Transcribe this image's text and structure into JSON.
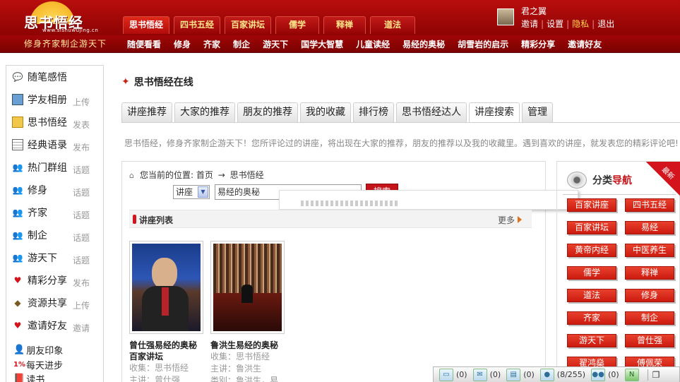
{
  "header": {
    "logo_text": "思书悟经",
    "logo_url": "www.sishuwujing.cn",
    "slogan": "修身齐家制企游天下",
    "top_tabs": [
      "思书悟经",
      "四书五经",
      "百家讲坛",
      "儒学",
      "释禅",
      "道法"
    ],
    "nav_links": [
      "随便看看",
      "修身",
      "齐家",
      "制企",
      "游天下",
      "国学大智慧",
      "儿童读经",
      "易经的奥秘",
      "胡雪岩的启示",
      "精彩分享",
      "邀请好友"
    ],
    "user": {
      "name": "君之翼",
      "links": [
        "邀请",
        "设置",
        "隐私",
        "退出"
      ]
    }
  },
  "sidebar": {
    "items": [
      {
        "label": "随笔感悟",
        "action": "",
        "icon": "chat-bubble-icon"
      },
      {
        "label": "学友相册",
        "action": "上传",
        "icon": "photo-icon"
      },
      {
        "label": "思书悟经",
        "action": "发表",
        "icon": "book-icon"
      },
      {
        "label": "经典语录",
        "action": "发布",
        "icon": "calendar-icon"
      },
      {
        "label": "热门群组",
        "action": "话题",
        "icon": "group-icon"
      },
      {
        "label": "修身",
        "action": "话题",
        "icon": "group-icon"
      },
      {
        "label": "齐家",
        "action": "话题",
        "icon": "group-icon"
      },
      {
        "label": "制企",
        "action": "话题",
        "icon": "group-icon"
      },
      {
        "label": "游天下",
        "action": "话题",
        "icon": "group-icon"
      },
      {
        "label": "精彩分享",
        "action": "发布",
        "icon": "hearts-icon"
      },
      {
        "label": "资源共享",
        "action": "上传",
        "icon": "diamond-icon"
      },
      {
        "label": "邀请好友",
        "action": "邀请",
        "icon": "hearts-icon"
      }
    ],
    "extras": [
      {
        "label": "朋友印象",
        "icon": "people-icon"
      },
      {
        "label": "每天进步",
        "prefix": "1%",
        "icon": "progress-icon"
      },
      {
        "label": "读书",
        "icon": "reading-icon"
      }
    ]
  },
  "main": {
    "title": "思书悟经在线",
    "tabs": [
      "讲座推荐",
      "大家的推荐",
      "朋友的推荐",
      "我的收藏",
      "排行榜",
      "思书悟经达人",
      "讲座搜索",
      "管理"
    ],
    "active_tab_index": 6,
    "description": "思书悟经，修身齐家制企游天下！您所评论过的讲座，将出现在大家的推荐，朋友的推荐以及我的收藏里。遇到喜欢的讲座，就发表您的精彩评论吧!",
    "breadcrumb": {
      "prefix": "您当前的位置:",
      "home": "首页",
      "arrow": "→",
      "current": "思书悟经"
    },
    "search": {
      "select_value": "讲座",
      "query": "易经的奥秘",
      "button": "搜索"
    },
    "list": {
      "title": "讲座列表",
      "more": "更多"
    },
    "cards": [
      {
        "title1": "曾仕强易经的奥秘",
        "title2": "百家讲坛",
        "meta1": "收集：思书悟经",
        "meta2": "主讲：曾仕强"
      },
      {
        "title1": "鲁洪生易经的奥秘",
        "title2": "",
        "meta1": "收集：思书悟经",
        "meta2": "主讲：鲁洪生",
        "meta3": "类别：鲁洪生，易"
      }
    ]
  },
  "right_panel": {
    "title_a": "分类",
    "title_b": "导航",
    "ribbon": "最新",
    "categories": [
      "百家讲座",
      "四书五经",
      "百家讲坛",
      "易经",
      "黄帝内经",
      "中医养生",
      "儒学",
      "释禅",
      "道法",
      "修身",
      "齐家",
      "制企",
      "游天下",
      "曾仕强",
      "翟鸿燊",
      "傅佩荣"
    ]
  },
  "tray": {
    "items": [
      {
        "icon": "comment-icon",
        "count": "(0)"
      },
      {
        "icon": "mail-icon",
        "count": "(0)"
      },
      {
        "icon": "notice-icon",
        "count": "(0)"
      },
      {
        "icon": "friends-icon",
        "count": "(8/255)"
      },
      {
        "icon": "group-chat-icon",
        "count": "(0)"
      },
      {
        "icon": "app-icon",
        "count": ""
      }
    ]
  }
}
